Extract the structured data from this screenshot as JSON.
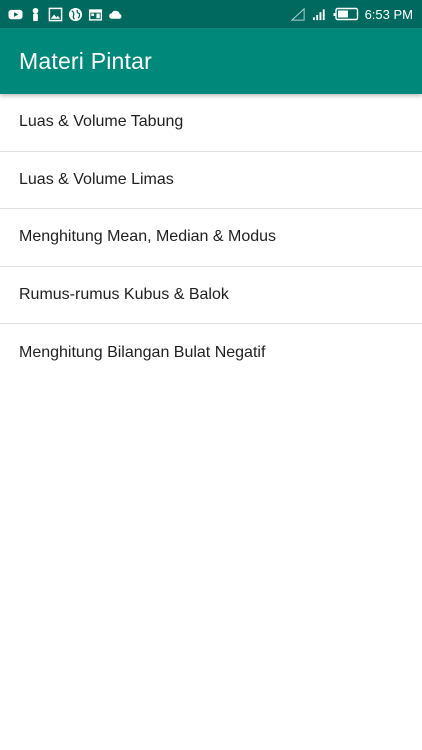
{
  "status_bar": {
    "left_icons": [
      "youtube-icon",
      "person-icon",
      "image-icon",
      "globe-icon",
      "calendar-icon",
      "cloud-icon"
    ],
    "right_icons": [
      "no-signal-icon",
      "signal-icon",
      "battery-icon"
    ],
    "time": "6:53 PM"
  },
  "toolbar": {
    "title": "Materi Pintar"
  },
  "list": {
    "items": [
      {
        "label": "Luas & Volume Tabung"
      },
      {
        "label": "Luas & Volume Limas"
      },
      {
        "label": "Menghitung Mean, Median & Modus"
      },
      {
        "label": "Rumus-rumus Kubus & Balok"
      },
      {
        "label": "Menghitung Bilangan Bulat Negatif"
      }
    ]
  },
  "colors": {
    "status_bar": "#00695f",
    "toolbar": "#00897b",
    "text": "#212121",
    "divider": "#e0e0e0"
  }
}
